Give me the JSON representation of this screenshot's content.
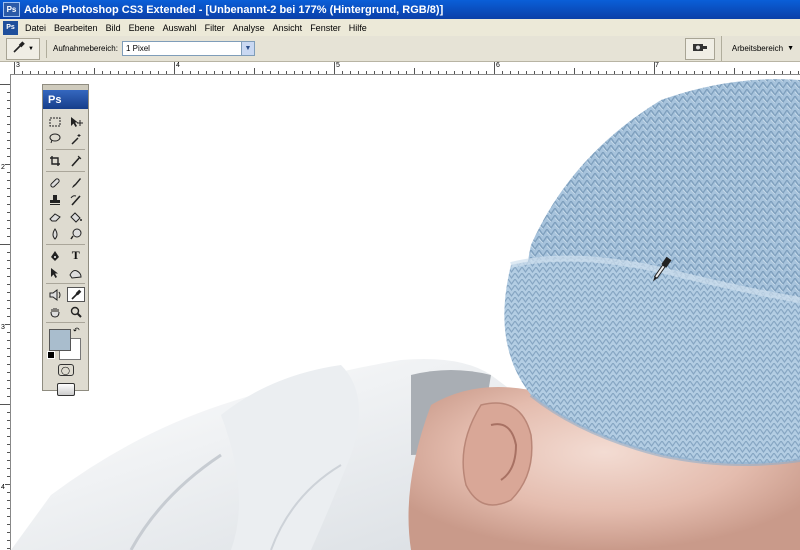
{
  "window": {
    "title": "Adobe Photoshop CS3 Extended - [Unbenannt-2 bei 177% (Hintergrund, RGB/8)]",
    "app_icon": "Ps"
  },
  "menu": {
    "items": [
      "Datei",
      "Bearbeiten",
      "Bild",
      "Ebene",
      "Auswahl",
      "Filter",
      "Analyse",
      "Ansicht",
      "Fenster",
      "Hilfe"
    ]
  },
  "options": {
    "sample_label": "Aufnahmebereich:",
    "sample_value": "1 Pixel",
    "workspace_label": "Arbeitsbereich"
  },
  "toolbox": {
    "logo": "Ps",
    "text_tool": "T"
  },
  "rulers": {
    "top": [
      "3",
      "4",
      "5",
      "6",
      "7"
    ],
    "left": [
      "2",
      "3",
      "4"
    ]
  },
  "colors": {
    "foreground": "#a9bdcd",
    "background": "#ffffff",
    "hat": "#a7c3dc"
  }
}
